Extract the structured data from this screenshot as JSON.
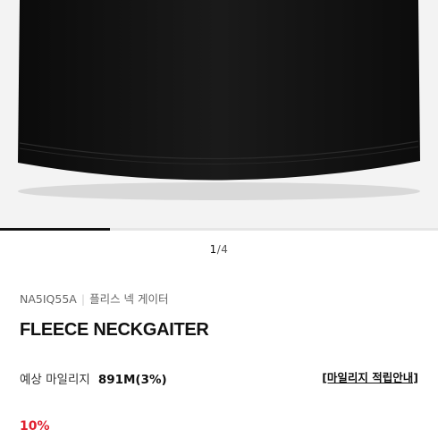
{
  "carousel": {
    "current": "1",
    "separator": "/",
    "total": "4",
    "progress": 0.25
  },
  "product": {
    "code": "NA5IQ55A",
    "separator": "|",
    "name_ko": "플리스 넥 게이터",
    "name_en": "FLEECE NECKGAITER"
  },
  "mileage": {
    "label": "예상 마일리지",
    "value": "891M(3%)",
    "guide_link": "[마일리지 적립안내]"
  },
  "price": {
    "discount": "10%"
  },
  "colors": {
    "accent_red": "#e0202f",
    "garment": "#121212"
  }
}
